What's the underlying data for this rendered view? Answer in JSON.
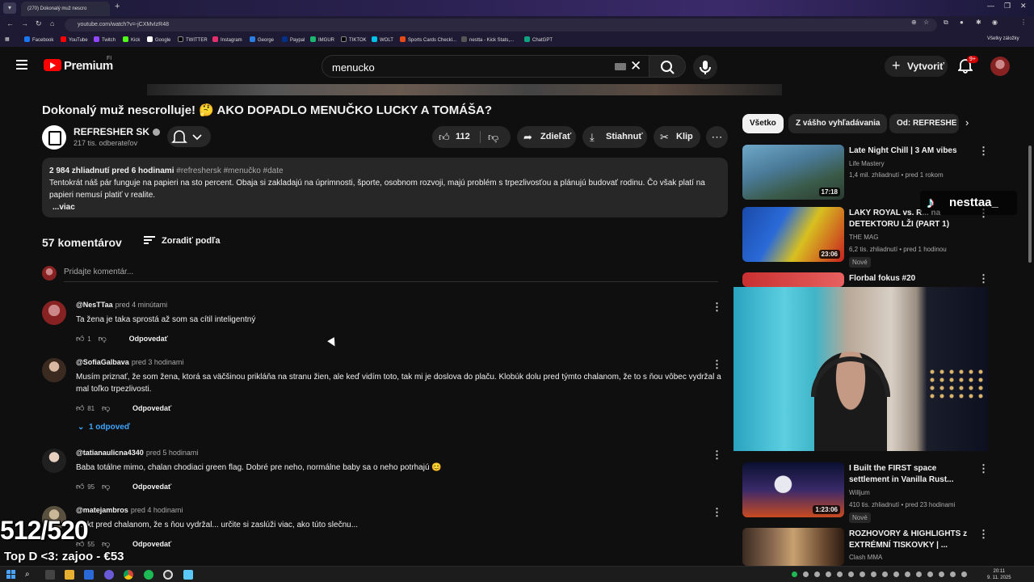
{
  "browser": {
    "tab_title": "(270) Dokonalý muž nescro",
    "url": "youtube.com/watch?v=-jCXMvIzR48",
    "bookmarks": [
      "Facebook",
      "YouTube",
      "Twitch",
      "Kick",
      "Google",
      "TWITTER",
      "Instagram",
      "George",
      "Paypal",
      "IMGUR",
      "TIKTOK",
      "WOLT",
      "Sports Cards Checkl...",
      "nestta - Kick Stats,...",
      "ChatGPT"
    ],
    "all_bookmarks": "Všetky záložky"
  },
  "header": {
    "logo": "Premium",
    "country": "FI",
    "search_value": "menucko",
    "create_label": "Vytvoriť",
    "notifications": "9+"
  },
  "video": {
    "title": "Dokonalý muž nescrolluje! 🤔 AKO DOPADLO MENUČKO LUCKY A TOMÁŠA?",
    "channel": "REFRESHER SK",
    "subscribers": "217 tis. odberateľov",
    "likes": "112",
    "share": "Zdieľať",
    "download": "Stiahnuť",
    "clip": "Klip"
  },
  "description": {
    "stats": "2 984 zhliadnutí  pred 6 hodinami",
    "tags": "#refreshersk #menučko #date",
    "text": "Tentokrát náš pár funguje na papieri na sto percent. Obaja si zakladajú na úprimnosti, športe, osobnom rozvoji, majú problém s trpezlivosťou a plánujú budovať rodinu. Čo však platí na papieri nemusí platiť v realite.",
    "more": "...viac"
  },
  "comments": {
    "count_label": "57 komentárov",
    "sort_label": "Zoradiť podľa",
    "add_placeholder": "Pridajte komentár...",
    "reply_label": "Odpovedať",
    "items": [
      {
        "author": "@NesTTaa",
        "time": "pred 4 minútami",
        "text": "Ta žena je taka sprostá až som sa cítil inteligentný",
        "likes": "1"
      },
      {
        "author": "@SofiaGalbava",
        "time": "pred 3 hodinami",
        "text": "Musím priznať, že som žena, ktorá sa väčšinou prikláňa na stranu žien, ale keď vidím toto, tak mi je doslova do plaču. Klobúk dolu pred týmto chalanom, že to s ňou vôbec vydržal a mal toľko trpezlivosti.",
        "likes": "81",
        "replies": "1 odpoveď"
      },
      {
        "author": "@tatianaulicna4340",
        "time": "pred 5 hodinami",
        "text": "Baba totálne mimo, chalan chodiaci green flag. Dobré pre neho, normálne baby sa o neho potrhajú 😊",
        "likes": "95"
      },
      {
        "author": "@matejambros",
        "time": "pred 4 hodinami",
        "text": "...ekt pred chalanom, že s ňou vydržal... určite si zaslúži viac, ako túto slečnu...",
        "likes": "55"
      }
    ]
  },
  "sidebar": {
    "chips": [
      "Všetko",
      "Z vášho vyhľadávania",
      "Od: REFRESHE"
    ],
    "videos": [
      {
        "title": "Late Night Chill | 3 AM vibes",
        "channel": "Life Mastery",
        "meta": "1,4 mil. zhliadnutí • pred 1 rokom",
        "duration": "17:18"
      },
      {
        "title": "LAKY ROYAL vs. R... na DETEKTORU LŽI (PART 1)",
        "channel": "THE MAG",
        "meta": "6,2 tis. zhliadnutí • pred 1 hodinou",
        "duration": "23:06",
        "badge": "Nové"
      },
      {
        "title": "Florbal fokus #20",
        "channel": "",
        "meta": "",
        "duration": ""
      },
      {
        "title": "I Built the FIRST space settlement in Vanilla Rust...",
        "channel": "Willjum",
        "meta": "410 tis. zhliadnutí • pred 23 hodinami",
        "duration": "1:23:06",
        "badge": "Nové"
      },
      {
        "title": "ROZHOVORY & HIGHLIGHTS z EXTRÉMNÍ TISKOVKY | ...",
        "channel": "Clash MMA",
        "meta": "",
        "duration": ""
      }
    ]
  },
  "overlay": {
    "tiktok_name": "nesttaa_",
    "goal": "512/520",
    "top_donor": "Top D <3: zajoo - €53"
  },
  "taskbar": {
    "time": "20:11",
    "date": "9. 11. 2025"
  }
}
